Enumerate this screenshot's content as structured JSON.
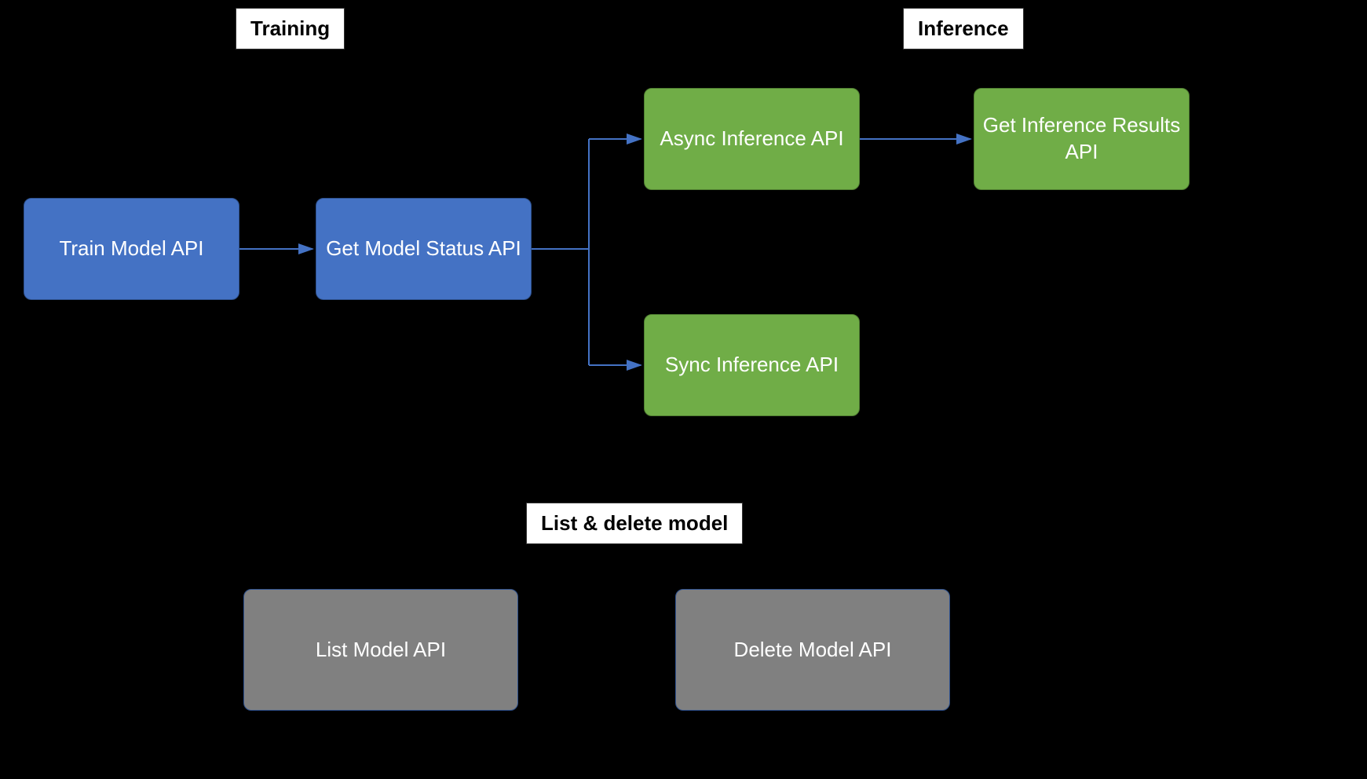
{
  "headers": {
    "training": "Training",
    "inference": "Inference",
    "listDelete": "List & delete model"
  },
  "boxes": {
    "trainModel": "Train Model API",
    "getModelStatus": "Get Model Status API",
    "asyncInference": "Async Inference API",
    "syncInference": "Sync Inference API",
    "getInferenceResults": "Get Inference Results API",
    "listModel": "List Model API",
    "deleteModel": "Delete Model API"
  }
}
